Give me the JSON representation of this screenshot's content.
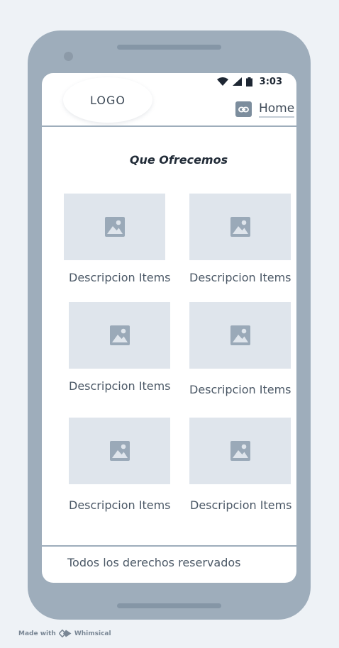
{
  "status_bar": {
    "time": "3:03"
  },
  "header": {
    "logo": "LOGO",
    "home_link": "Home"
  },
  "main": {
    "title": "Que Ofrecemos",
    "items": [
      {
        "description": "Descripcion Items"
      },
      {
        "description": "Descripcion Items"
      },
      {
        "description": "Descripcion Items"
      },
      {
        "description": "Descripcion Items"
      },
      {
        "description": "Descripcion Items"
      },
      {
        "description": "Descripcion Items"
      }
    ]
  },
  "footer": {
    "text": "Todos los derechos reservados"
  },
  "watermark": {
    "made_with": "Made with",
    "brand": "Whimsical"
  },
  "colors": {
    "phone_frame": "#9eadbb",
    "placeholder": "#dfe5ec",
    "placeholder_icon": "#9aa9b8",
    "text": "#4b5866"
  }
}
